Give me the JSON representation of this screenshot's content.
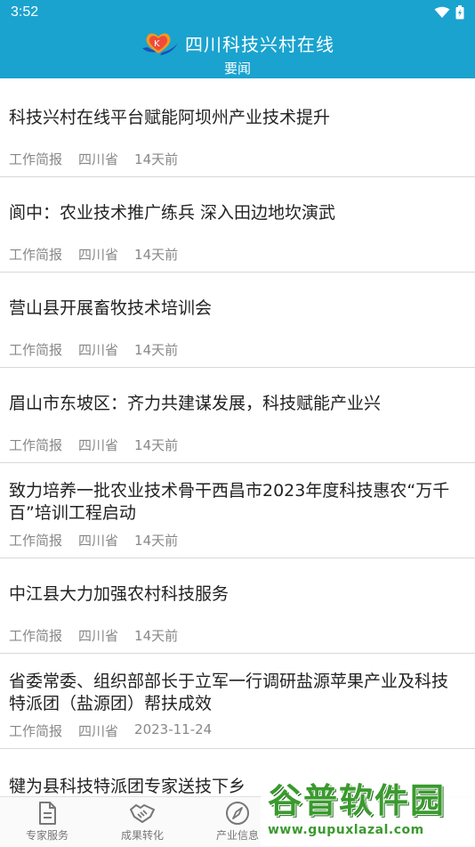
{
  "status_bar": {
    "time": "3:52"
  },
  "header": {
    "app_title": "四川科技兴村在线",
    "subtitle": "要闻",
    "logo_letter": "K"
  },
  "news": [
    {
      "title": "科技兴村在线平台赋能阿坝州产业技术提升",
      "category": "工作简报",
      "region": "四川省",
      "time": "14天前"
    },
    {
      "title": "阆中：农业技术推广练兵 深入田边地坎演武",
      "category": "工作简报",
      "region": "四川省",
      "time": "14天前"
    },
    {
      "title": "营山县开展畜牧技术培训会",
      "category": "工作简报",
      "region": "四川省",
      "time": "14天前"
    },
    {
      "title": "眉山市东坡区：齐力共建谋发展，科技赋能产业兴",
      "category": "工作简报",
      "region": "四川省",
      "time": "14天前"
    },
    {
      "title": "致力培养一批农业技术骨干西昌市2023年度科技惠农“万千百”培训工程启动",
      "category": "工作简报",
      "region": "四川省",
      "time": "14天前"
    },
    {
      "title": "中江县大力加强农村科技服务",
      "category": "工作简报",
      "region": "四川省",
      "time": "14天前"
    },
    {
      "title": "省委常委、组织部部长于立军一行调研盐源苹果产业及科技特派团（盐源团）帮扶成效",
      "category": "工作简报",
      "region": "四川省",
      "time": "2023-11-24"
    },
    {
      "title": "犍为县科技特派团专家送技下乡",
      "category": "",
      "region": "",
      "time": ""
    }
  ],
  "bottom_nav": [
    {
      "label": "专家服务",
      "icon": "document-icon"
    },
    {
      "label": "成果转化",
      "icon": "handshake-icon"
    },
    {
      "label": "产业信息",
      "icon": "compass-icon"
    }
  ],
  "watermark": {
    "text": "谷普软件园",
    "url": "www.gupuxlazal.com"
  },
  "colors": {
    "primary": "#1aa3cf",
    "meta": "#888888",
    "divider": "#d8d8d8"
  }
}
